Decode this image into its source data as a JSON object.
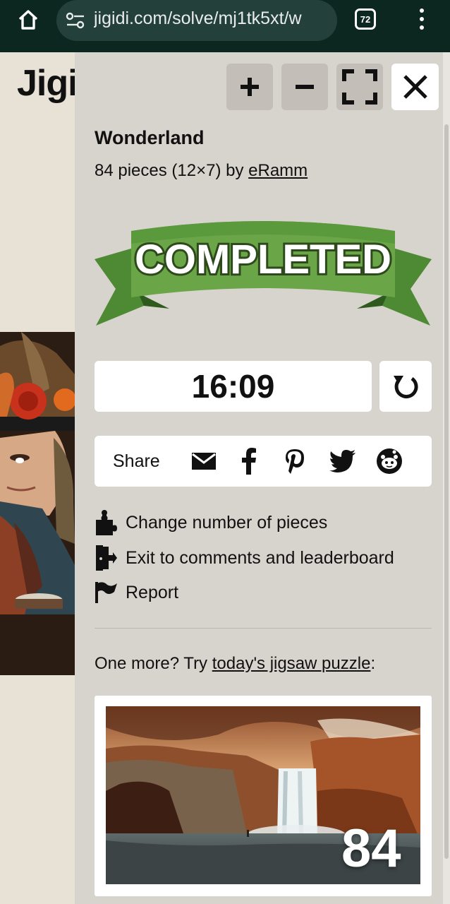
{
  "browser": {
    "url": "jigidi.com/solve/mj1tk5xt/w",
    "tab_count": "72"
  },
  "site": {
    "logo": "Jigidi"
  },
  "toolbar": {
    "zoom_in": "+",
    "zoom_out": "−"
  },
  "puzzle": {
    "title": "Wonderland",
    "meta_prefix": "84 pieces (12×7) by ",
    "author": "eRamm",
    "status_banner": "COMPLETED",
    "timer": "16:09"
  },
  "share": {
    "label": "Share",
    "icons": [
      "email-icon",
      "facebook-icon",
      "pinterest-icon",
      "twitter-icon",
      "reddit-icon"
    ]
  },
  "actions": [
    {
      "label": "Change number of pieces",
      "icon": "puzzle-piece-icon"
    },
    {
      "label": "Exit to comments and leaderboard",
      "icon": "exit-door-icon"
    },
    {
      "label": "Report",
      "icon": "flag-icon"
    }
  ],
  "promo": {
    "prefix": "One more? Try ",
    "link": "today's jigsaw puzzle",
    "suffix": ":",
    "piece_count": "84"
  },
  "colors": {
    "panel_bg": "#d7d3cd",
    "ribbon_green": "#5b9a3c",
    "browser_bar": "#0c2620"
  }
}
